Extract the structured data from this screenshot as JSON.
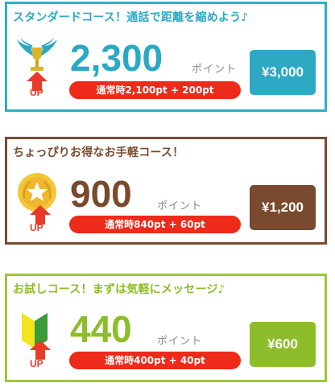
{
  "plans": [
    {
      "title": "スタンダードコース！通話で距離を縮めよう♪",
      "badge_icon": "winged-trophy-icon",
      "up_label": "UP",
      "points": "2,300",
      "unit": "ポイント",
      "breakdown": "通常時2,100pt + 200pt",
      "price": "¥3,000",
      "color": "#2ba9c4"
    },
    {
      "title": "ちょっぴりお得なお手軽コース！",
      "badge_icon": "gold-star-medal-icon",
      "up_label": "UP",
      "points": "900",
      "unit": "ポイント",
      "breakdown": "通常時840pt + 60pt",
      "price": "¥1,200",
      "color": "#7a4a2e"
    },
    {
      "title": "お試しコース！まずは気軽にメッセージ♪",
      "badge_icon": "beginner-mark-icon",
      "up_label": "UP",
      "points": "440",
      "unit": "ポイント",
      "breakdown": "通常時400pt + 40pt",
      "price": "¥600",
      "color": "#8dbd2b"
    }
  ],
  "colors": {
    "up_arrow": "#e8392a",
    "pill": "#ee2a1b"
  }
}
